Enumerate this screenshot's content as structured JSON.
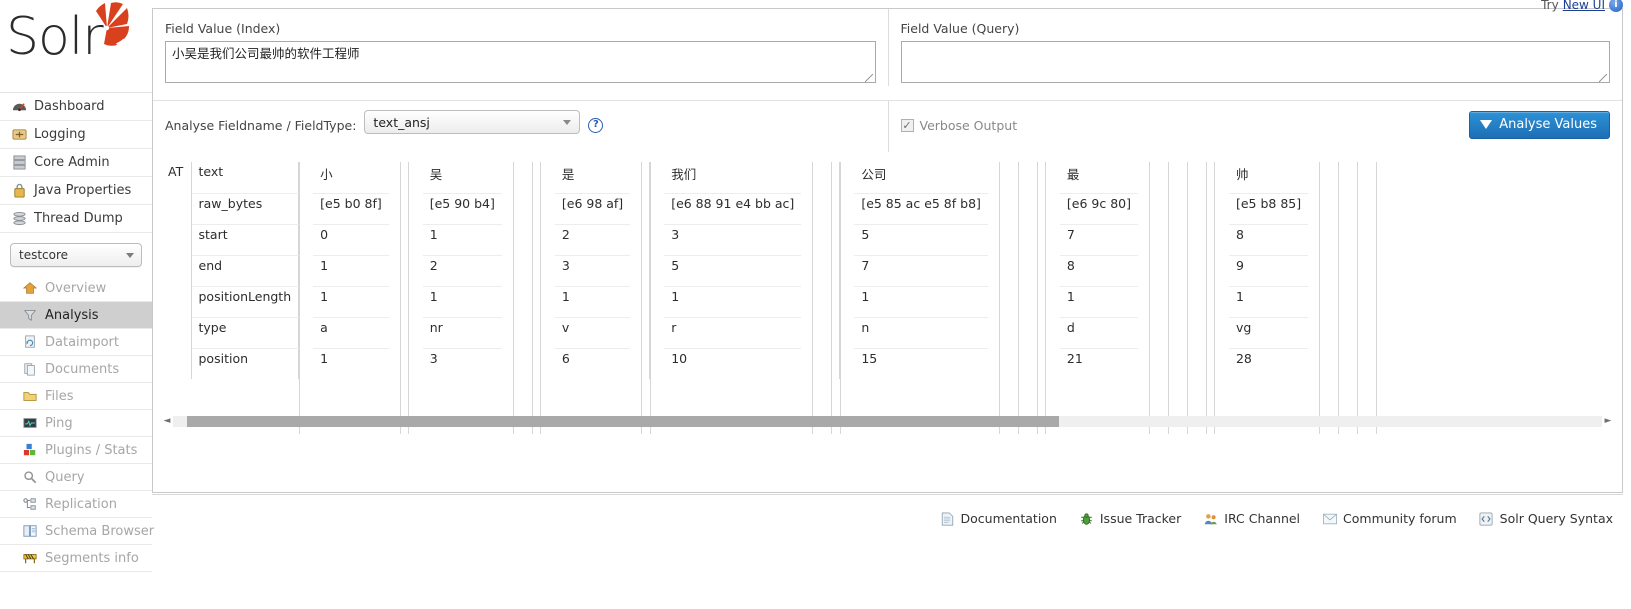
{
  "topbar": {
    "try_label": "Try",
    "new_ui_link": "New UI",
    "info_icon": "info-icon",
    "info_glyph": "i"
  },
  "brand": {
    "name": "Solr",
    "logo_icon": "solr-burst-logo"
  },
  "sidebar": {
    "global_items": [
      {
        "label": "Dashboard",
        "icon": "dashboard-icon"
      },
      {
        "label": "Logging",
        "icon": "logging-icon"
      },
      {
        "label": "Core Admin",
        "icon": "core-admin-icon"
      },
      {
        "label": "Java Properties",
        "icon": "java-properties-icon"
      },
      {
        "label": "Thread Dump",
        "icon": "thread-dump-icon"
      }
    ],
    "core_selector": {
      "value": "testcore",
      "icon": "chevron-down-icon"
    },
    "core_items": [
      {
        "label": "Overview",
        "icon": "house-icon",
        "active": false
      },
      {
        "label": "Analysis",
        "icon": "funnel-icon",
        "active": true
      },
      {
        "label": "Dataimport",
        "icon": "dataimport-icon",
        "active": false
      },
      {
        "label": "Documents",
        "icon": "documents-icon",
        "active": false
      },
      {
        "label": "Files",
        "icon": "folder-icon",
        "active": false
      },
      {
        "label": "Ping",
        "icon": "ping-icon",
        "active": false
      },
      {
        "label": "Plugins / Stats",
        "icon": "plugins-icon",
        "active": false
      },
      {
        "label": "Query",
        "icon": "magnifier-icon",
        "active": false
      },
      {
        "label": "Replication",
        "icon": "replication-icon",
        "active": false
      },
      {
        "label": "Schema Browser",
        "icon": "book-icon",
        "active": false
      },
      {
        "label": "Segments info",
        "icon": "segments-icon",
        "active": false
      }
    ]
  },
  "form": {
    "index": {
      "label": "Field Value (Index)",
      "value": "小吴是我们公司最帅的软件工程师",
      "placeholder": ""
    },
    "query": {
      "label": "Field Value (Query)",
      "value": "",
      "placeholder": ""
    },
    "fieldtype": {
      "label": "Analyse Fieldname / FieldType:",
      "value": "text_ansj",
      "help_glyph": "?"
    },
    "verbose": {
      "label": "Verbose Output",
      "checked": true,
      "check_glyph": "✓"
    },
    "analyse_button": {
      "label": "Analyse Values",
      "icon": "funnel-icon"
    }
  },
  "analysis": {
    "analyzer_label": "AT",
    "attribute_rows": [
      "text",
      "raw_bytes",
      "start",
      "end",
      "positionLength",
      "type",
      "position"
    ],
    "tokens": [
      {
        "text": "小",
        "raw_bytes": "[e5 b0 8f]",
        "start": "0",
        "end": "1",
        "positionLength": "1",
        "type": "a",
        "position": "1"
      },
      {
        "text": "吴",
        "raw_bytes": "[e5 90 b4]",
        "start": "1",
        "end": "2",
        "positionLength": "1",
        "type": "nr",
        "position": "3"
      },
      {
        "text": "是",
        "raw_bytes": "[e6 98 af]",
        "start": "2",
        "end": "3",
        "positionLength": "1",
        "type": "v",
        "position": "6"
      },
      {
        "text": "我们",
        "raw_bytes": "[e6 88 91 e4 bb ac]",
        "start": "3",
        "end": "5",
        "positionLength": "1",
        "type": "r",
        "position": "10"
      },
      {
        "text": "公司",
        "raw_bytes": "[e5 85 ac e5 8f b8]",
        "start": "5",
        "end": "7",
        "positionLength": "1",
        "type": "n",
        "position": "15"
      },
      {
        "text": "最",
        "raw_bytes": "[e6 9c 80]",
        "start": "7",
        "end": "8",
        "positionLength": "1",
        "type": "d",
        "position": "21"
      },
      {
        "text": "帅",
        "raw_bytes": "[e5 b8 85]",
        "start": "8",
        "end": "9",
        "positionLength": "1",
        "type": "vg",
        "position": "28"
      }
    ]
  },
  "scrollbar": {
    "left_arrow": "◄",
    "right_arrow": "►"
  },
  "footer": {
    "links": [
      {
        "label": "Documentation",
        "icon": "document-icon",
        "glyph": "📄"
      },
      {
        "label": "Issue Tracker",
        "icon": "bug-icon",
        "glyph": "🐛"
      },
      {
        "label": "IRC Channel",
        "icon": "people-icon",
        "glyph": "👥"
      },
      {
        "label": "Community forum",
        "icon": "envelope-icon",
        "glyph": "✉"
      },
      {
        "label": "Solr Query Syntax",
        "icon": "code-icon",
        "glyph": "▣"
      }
    ]
  },
  "colors": {
    "accent": "#1d6fb5",
    "brand_red": "#d9411e",
    "active_nav": "#cfcfcf"
  }
}
